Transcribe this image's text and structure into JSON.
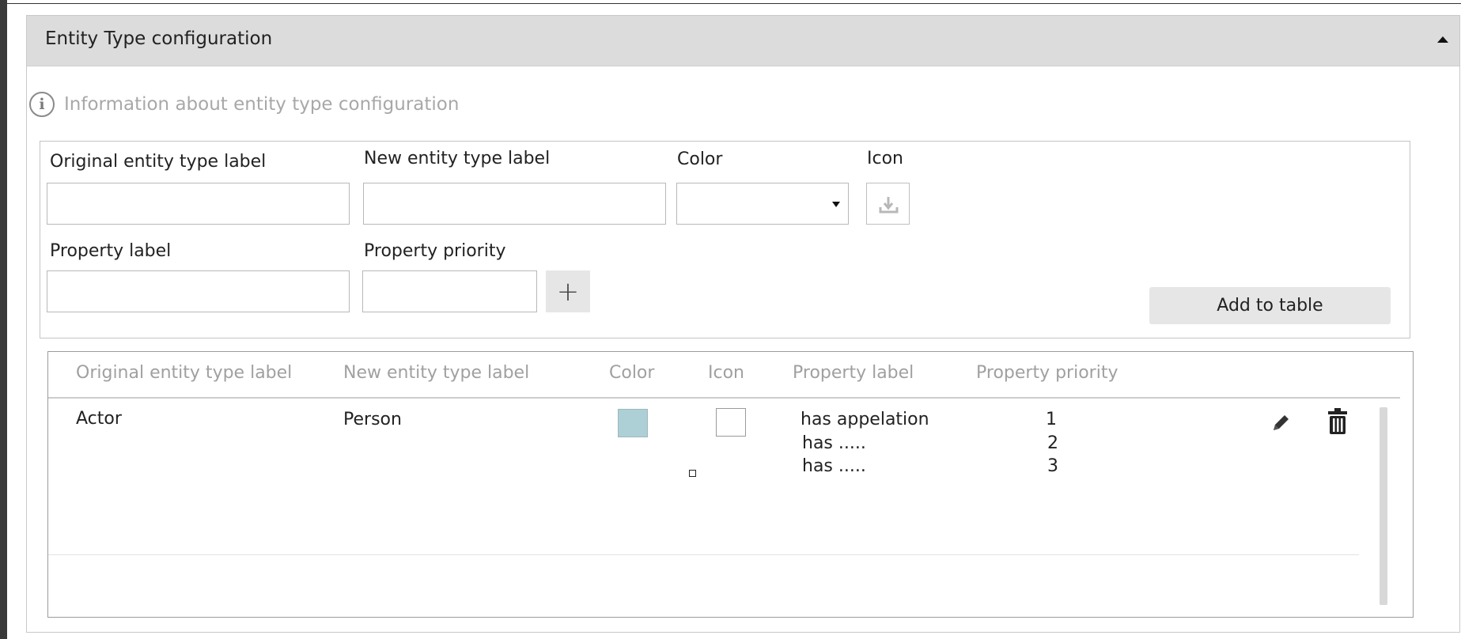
{
  "panel": {
    "title": "Entity Type configuration",
    "info_text": "Information about entity type configuration"
  },
  "form": {
    "original_label": "Original entity type label",
    "new_label": "New entity type label",
    "color_label": "Color",
    "icon_label": "Icon",
    "property_label": "Property label",
    "property_priority_label": "Property priority",
    "plus_symbol": "+",
    "add_button": "Add to table"
  },
  "table": {
    "columns": [
      "Original entity type label",
      "New entity type label",
      "Color",
      "Icon",
      "Property label",
      "Property priority"
    ],
    "rows": [
      {
        "original": "Actor",
        "new": "Person",
        "color": "#adcfd6",
        "properties": [
          {
            "label": "has appelation",
            "priority": "1"
          },
          {
            "label": "has .....",
            "priority": "2"
          },
          {
            "label": "has .....",
            "priority": "3"
          }
        ]
      }
    ]
  },
  "icons": {
    "collapse": "caret-up-icon",
    "info": "info-circle-icon",
    "icon_picker": "download-tray-icon",
    "edit": "pencil-icon",
    "delete": "trash-icon"
  }
}
